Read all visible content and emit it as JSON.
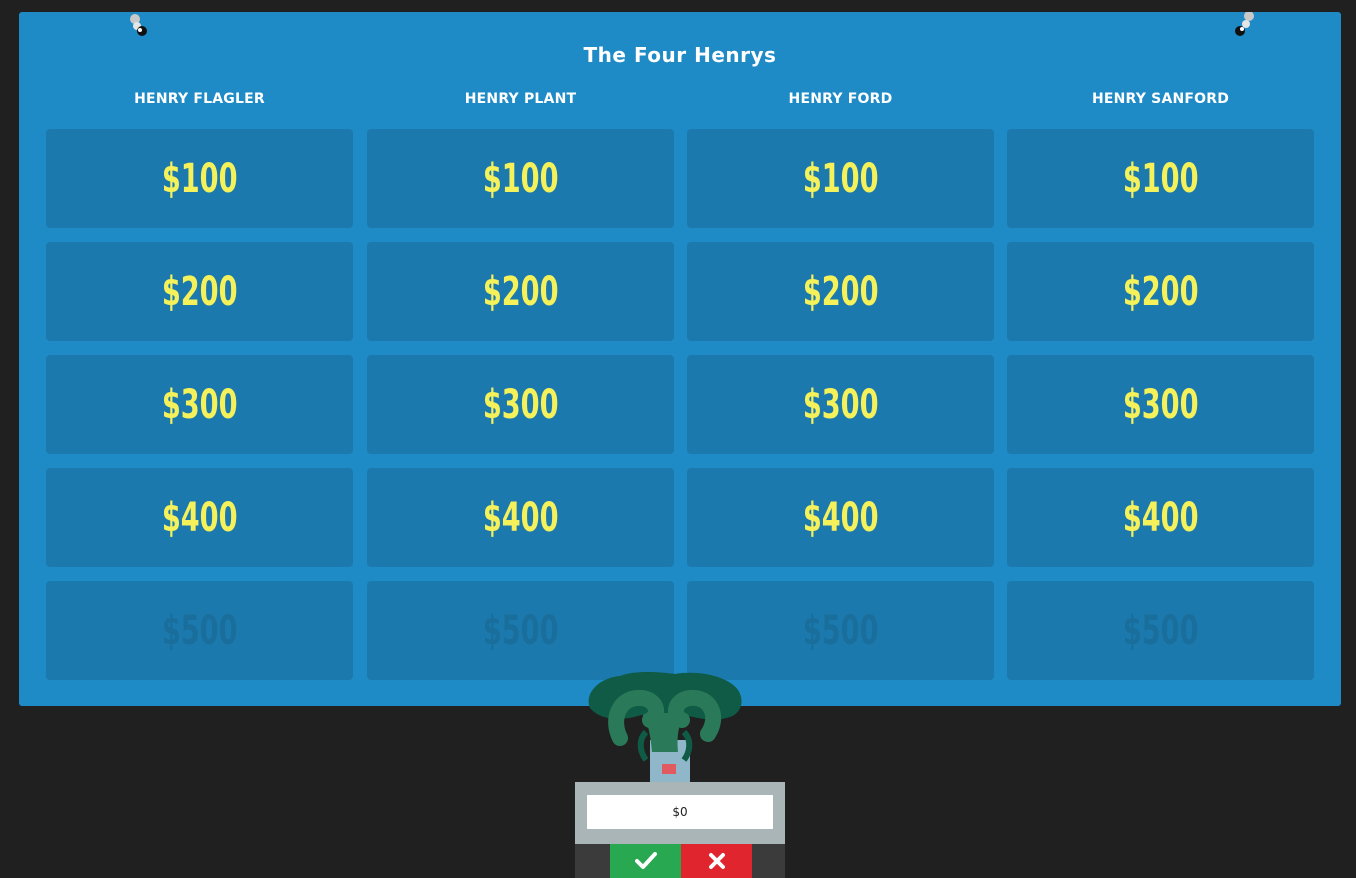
{
  "board": {
    "title": "The Four Henrys",
    "categories": [
      {
        "name": "HENRY FLAGLER",
        "values": [
          "$100",
          "$200",
          "$300",
          "$400",
          "$500"
        ]
      },
      {
        "name": "HENRY PLANT",
        "values": [
          "$100",
          "$200",
          "$300",
          "$400",
          "$500"
        ]
      },
      {
        "name": "HENRY FORD",
        "values": [
          "$100",
          "$200",
          "$300",
          "$400",
          "$500"
        ]
      },
      {
        "name": "HENRY SANFORD",
        "values": [
          "$100",
          "$200",
          "$300",
          "$400",
          "$500"
        ]
      }
    ],
    "used_row": 4
  },
  "player": {
    "score": "$0",
    "correct_icon": "checkmark-icon",
    "wrong_icon": "x-icon"
  },
  "colors": {
    "board": "#1f8bc6",
    "cell": "#1b79ad",
    "value_text": "#f5f15a",
    "correct": "#27a851",
    "wrong": "#e0252e"
  }
}
